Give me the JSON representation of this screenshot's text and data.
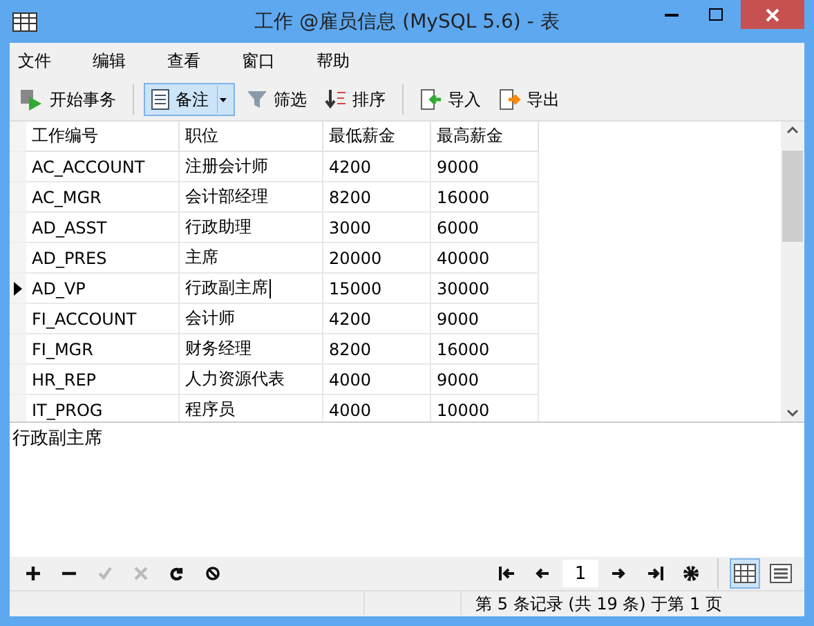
{
  "window": {
    "title": "工作 @雇员信息 (MySQL 5.6) - 表"
  },
  "menu": [
    "文件",
    "编辑",
    "查看",
    "窗口",
    "帮助"
  ],
  "toolbar": [
    {
      "kind": "transaction",
      "label": "开始事务",
      "selected": false
    },
    {
      "kind": "memo",
      "label": "备注",
      "selected": true
    },
    {
      "kind": "filter",
      "label": "筛选",
      "selected": false
    },
    {
      "kind": "sort",
      "label": "排序",
      "selected": false
    },
    {
      "kind": "import",
      "label": "导入",
      "selected": false
    },
    {
      "kind": "export",
      "label": "导出",
      "selected": false
    }
  ],
  "table": {
    "columns": [
      "工作编号",
      "职位",
      "最低薪金",
      "最高薪金"
    ],
    "rows": [
      {
        "cells": [
          "AC_ACCOUNT",
          "注册会计师",
          "4200",
          "9000"
        ],
        "selected": false
      },
      {
        "cells": [
          "AC_MGR",
          "会计部经理",
          "8200",
          "16000"
        ],
        "selected": false
      },
      {
        "cells": [
          "AD_ASST",
          "行政助理",
          "3000",
          "6000"
        ],
        "selected": false
      },
      {
        "cells": [
          "AD_PRES",
          "主席",
          "20000",
          "40000"
        ],
        "selected": false
      },
      {
        "cells": [
          "AD_VP",
          "行政副主席",
          "15000",
          "30000"
        ],
        "selected": true
      },
      {
        "cells": [
          "FI_ACCOUNT",
          "会计师",
          "4200",
          "9000"
        ],
        "selected": false
      },
      {
        "cells": [
          "FI_MGR",
          "财务经理",
          "8200",
          "16000"
        ],
        "selected": false
      },
      {
        "cells": [
          "HR_REP",
          "人力资源代表",
          "4000",
          "9000"
        ],
        "selected": false
      },
      {
        "cells": [
          "IT_PROG",
          "程序员",
          "4000",
          "10000"
        ],
        "selected": false
      }
    ]
  },
  "memo": {
    "value": "行政副主席"
  },
  "record_tools": [
    {
      "kind": "add",
      "disabled": false
    },
    {
      "kind": "remove",
      "disabled": false
    },
    {
      "kind": "apply",
      "disabled": true
    },
    {
      "kind": "cancel",
      "disabled": true
    },
    {
      "kind": "refresh",
      "disabled": false
    },
    {
      "kind": "stop",
      "disabled": false
    }
  ],
  "pager": {
    "page": "1"
  },
  "views": [
    {
      "kind": "grid",
      "selected": true
    },
    {
      "kind": "form",
      "selected": false
    }
  ],
  "status_bar": {
    "text": "第 5 条记录 (共 19 条) 于第 1 页"
  }
}
